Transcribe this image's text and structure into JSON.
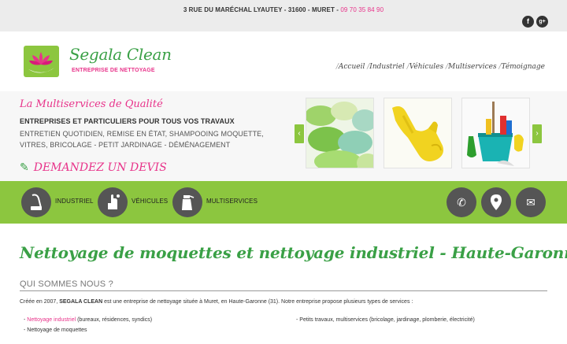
{
  "topbar": {
    "address": "3 RUE DU MARÉCHAL LYAUTEY - 31600 - MURET - ",
    "phone": "09 70 35 84 90",
    "social": [
      {
        "icon": "facebook-icon",
        "glyph": "f"
      },
      {
        "icon": "google-plus-icon",
        "glyph": "g+"
      }
    ]
  },
  "header": {
    "logo_title": "Segala Clean",
    "logo_subtitle": "ENTREPRISE DE NETTOYAGE",
    "nav": [
      "Accueil",
      "Industriel",
      "Véhicules",
      "Multiservices",
      "Témoignage"
    ],
    "nav_separator": "/"
  },
  "hero": {
    "tagline": "La Multiservices de Qualité",
    "pitch": "ENTREPRISES ET PARTICULIERS POUR TOUS VOS TRAVAUX",
    "services_line1": "ENTRETIEN QUOTIDIEN, REMISE EN ÉTAT, SHAMPOOING MOQUETTE,",
    "services_line2": "VITRES, BRICOLAGE - PETIT JARDINAGE - DÉMÉNAGEMENT",
    "cta": "DEMANDEZ UN DEVIS",
    "carousel_prev": "‹",
    "carousel_next": "›"
  },
  "servicebar": {
    "items": [
      {
        "label": "INDUSTRIEL",
        "icon": "vacuum-icon"
      },
      {
        "label": "VÉHICULES",
        "icon": "hand-wash-icon"
      },
      {
        "label": "MULTISERVICES",
        "icon": "spray-bottle-icon"
      }
    ],
    "contact": [
      {
        "icon": "phone-icon",
        "glyph": "✆"
      },
      {
        "icon": "map-pin-icon",
        "glyph": "●"
      },
      {
        "icon": "mail-icon",
        "glyph": "✉"
      }
    ]
  },
  "content": {
    "title": "Nettoyage de moquettes et nettoyage industriel - Haute-Garonne",
    "section_title": "QUI SOMMES NOUS ?",
    "intro_prefix": "Créée en 2007, ",
    "intro_brand": "SEGALA CLEAN",
    "intro_rest": " est une entreprise de nettoyage située à Muret, en Haute-Garonne (31). Notre entreprise propose plusieurs types de services :",
    "list_col1": [
      {
        "dash": "- ",
        "link": "Nettoyage industriel",
        "rest": " (bureaux, résidences, syndics)"
      },
      {
        "dash": "- ",
        "link": "",
        "rest": "Nettoyage de moquettes"
      }
    ],
    "list_col2": [
      {
        "dash": "- ",
        "link": "",
        "rest": "Petits travaux, multiservices (bricolage, jardinage, plomberie, électricité)"
      }
    ]
  },
  "colors": {
    "green": "#8cc63f",
    "dark_green": "#3aa046",
    "pink": "#e8338a",
    "dark_circle": "#555555"
  }
}
